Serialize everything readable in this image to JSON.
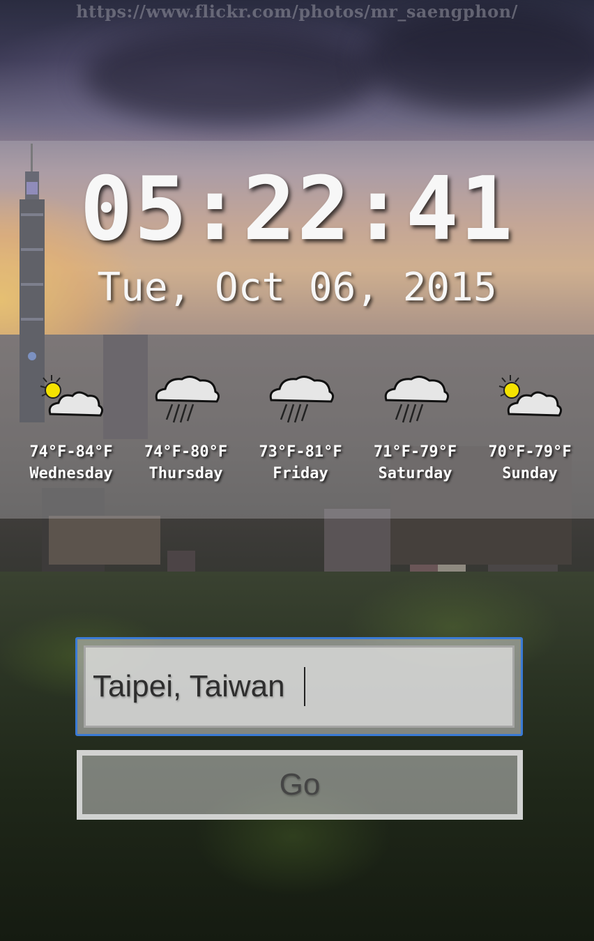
{
  "watermark": "https://www.flickr.com/photos/mr_saengphon/",
  "clock": {
    "time": "05:22:41",
    "date": "Tue, Oct 06, 2015"
  },
  "forecast": [
    {
      "temp": "74°F-84°F",
      "day": "Wednesday",
      "icon": "partly-cloudy-icon"
    },
    {
      "temp": "74°F-80°F",
      "day": "Thursday",
      "icon": "rain-icon"
    },
    {
      "temp": "73°F-81°F",
      "day": "Friday",
      "icon": "rain-icon"
    },
    {
      "temp": "71°F-79°F",
      "day": "Saturday",
      "icon": "rain-icon"
    },
    {
      "temp": "70°F-79°F",
      "day": "Sunday",
      "icon": "partly-cloudy-icon"
    }
  ],
  "search": {
    "value": "Taipei, Taiwan",
    "button_label": "Go"
  },
  "colors": {
    "focus_border": "#3a7bd5",
    "text": "#f7f7f7",
    "sun": "#f5e300"
  }
}
